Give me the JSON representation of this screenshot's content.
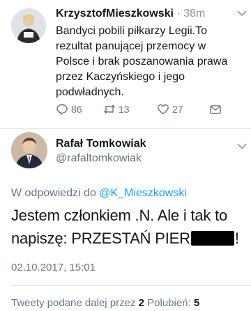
{
  "tweet": {
    "author_name": "KrzysztofMieszkowski",
    "time_separator": "·",
    "time": "38m",
    "text": "Bandyci pobili piłkarzy Legii.To rezultat panującej przemocy w Polsce i brak poszanowania prawa przez Kaczyńskiego i jego podwładnych.",
    "actions": {
      "reply_count": "86",
      "retweet_count": "13",
      "like_count": "27"
    }
  },
  "reply": {
    "author_name": "Rafał Tomkowiak",
    "author_handle": "@rafaltomkowiak",
    "reply_to_prefix": "W odpowiedzi do",
    "reply_to_handle": "@K_Mieszkowski",
    "text_before_redaction": "Jestem członkiem .N. Ale i tak to napiszę: PRZESTAŃ PIER",
    "text_after_redaction": "!",
    "date": "02.10.2017, 15:01",
    "stats": {
      "retweets_label": "Tweety podane dalej przez",
      "retweets_value": "2",
      "likes_label": "Polubień:",
      "likes_value": "5"
    }
  },
  "colors": {
    "accent": "#1da1f2",
    "text_primary": "#14171a",
    "text_secondary": "#657786",
    "divider": "#e1e8ed",
    "redaction": "#000000"
  },
  "icons": [
    "reply-icon",
    "retweet-icon",
    "like-icon",
    "direct-message-icon",
    "chevron-down-icon"
  ]
}
